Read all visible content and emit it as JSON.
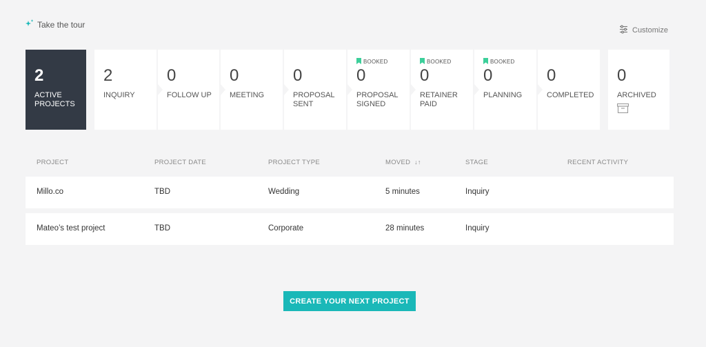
{
  "header": {
    "tour_label": "Take the tour",
    "customize_label": "Customize"
  },
  "pipeline": {
    "stages": [
      {
        "count": "2",
        "label": "ACTIVE PROJECTS",
        "booked": ""
      },
      {
        "count": "2",
        "label": "INQUIRY",
        "booked": ""
      },
      {
        "count": "0",
        "label": "FOLLOW UP",
        "booked": ""
      },
      {
        "count": "0",
        "label": "MEETING",
        "booked": ""
      },
      {
        "count": "0",
        "label": "PROPOSAL SENT",
        "booked": ""
      },
      {
        "count": "0",
        "label": "PROPOSAL SIGNED",
        "booked": "BOOKED"
      },
      {
        "count": "0",
        "label": "RETAINER PAID",
        "booked": "BOOKED"
      },
      {
        "count": "0",
        "label": "PLANNING",
        "booked": "BOOKED"
      },
      {
        "count": "0",
        "label": "COMPLETED",
        "booked": ""
      },
      {
        "count": "0",
        "label": "ARCHIVED",
        "booked": ""
      }
    ]
  },
  "table": {
    "columns": [
      "PROJECT",
      "PROJECT DATE",
      "PROJECT TYPE",
      "MOVED",
      "STAGE",
      "RECENT ACTIVITY"
    ],
    "rows": [
      {
        "project": "Millo.co",
        "date": "TBD",
        "type": "Wedding",
        "moved": "5 minutes",
        "stage": "Inquiry",
        "activity": ""
      },
      {
        "project": "Mateo’s test project",
        "date": "TBD",
        "type": "Corporate",
        "moved": "28 minutes",
        "stage": "Inquiry",
        "activity": ""
      }
    ]
  },
  "cta": {
    "label": "CREATE YOUR NEXT PROJECT"
  },
  "colors": {
    "accent": "#1ab8b8",
    "active_stage": "#333a45",
    "booked_flag": "#3ccf9a",
    "background": "#f4f4f5"
  }
}
